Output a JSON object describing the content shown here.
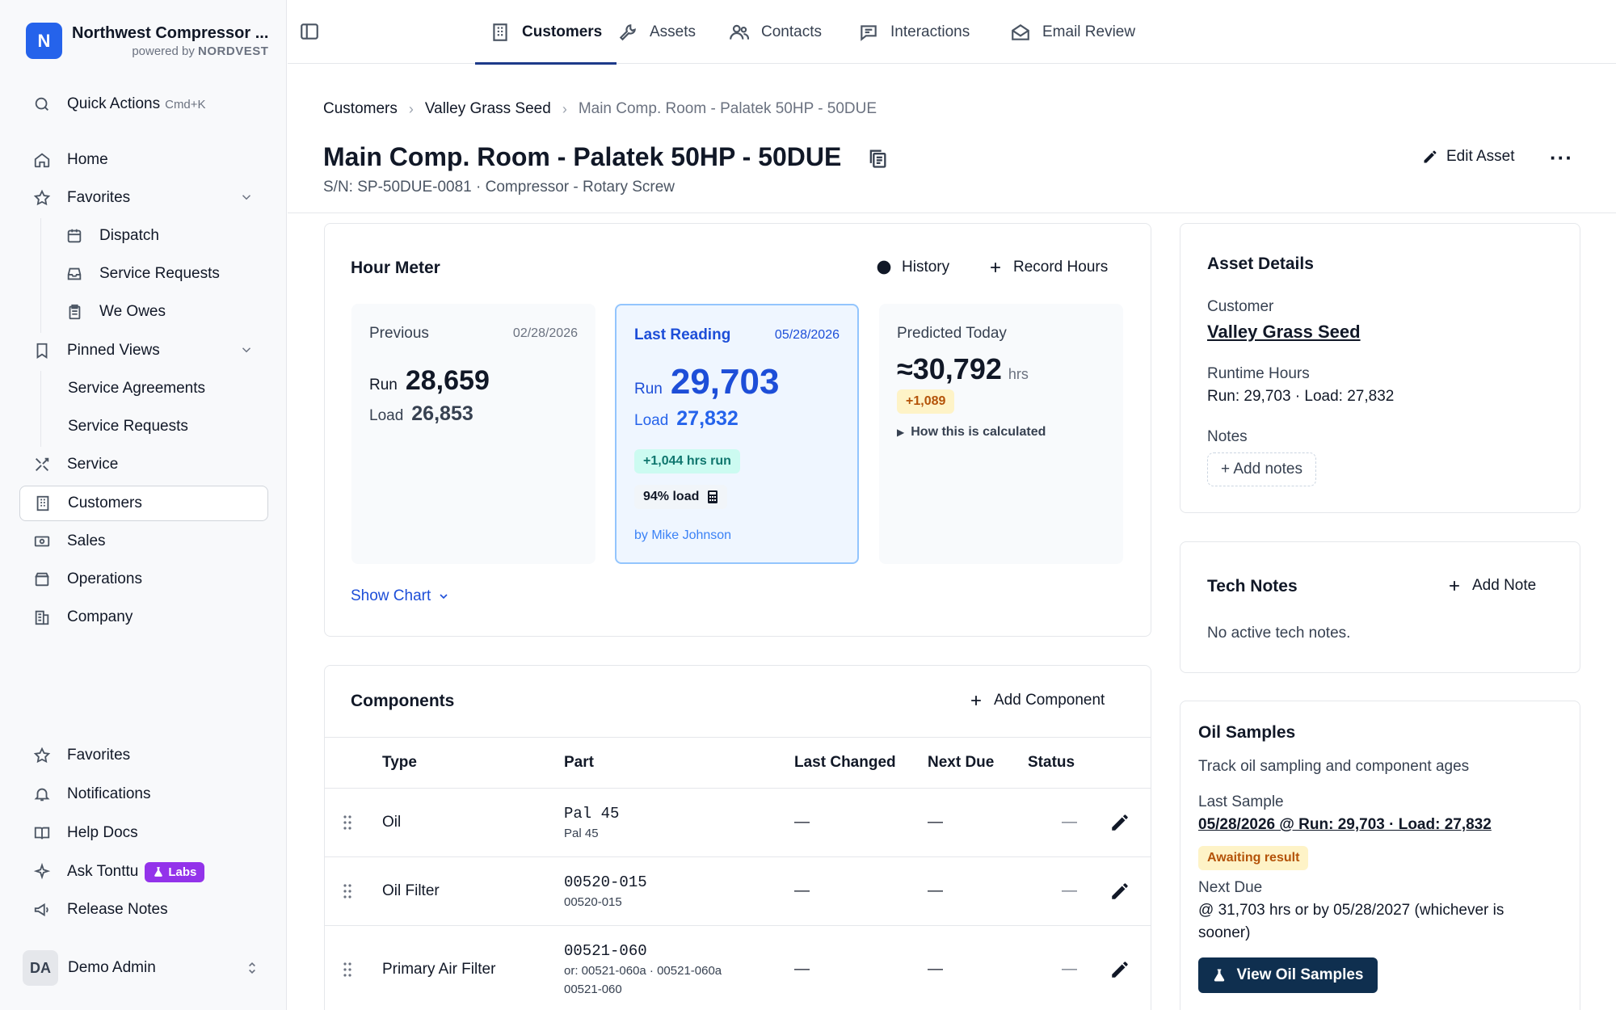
{
  "org": {
    "logo_letter": "N",
    "name": "Northwest Compressor ...",
    "powered_prefix": "powered by",
    "powered_brand": "NORDVEST"
  },
  "sidebar": {
    "quick_actions": {
      "label": "Quick Actions",
      "shortcut": "Cmd+K",
      "icon": "search-icon"
    },
    "home": {
      "label": "Home",
      "icon": "home-icon"
    },
    "favorites": {
      "label": "Favorites",
      "icon": "star-icon"
    },
    "favorites_items": [
      {
        "label": "Dispatch",
        "icon": "calendar-icon"
      },
      {
        "label": "Service Requests",
        "icon": "inbox-icon"
      },
      {
        "label": "We Owes",
        "icon": "clipboard-icon"
      }
    ],
    "pinned": {
      "label": "Pinned Views",
      "icon": "bookmark-icon"
    },
    "pinned_items": [
      {
        "label": "Service Agreements"
      },
      {
        "label": "Service Requests"
      }
    ],
    "main_items": [
      {
        "label": "Service",
        "icon": "tools-icon"
      },
      {
        "label": "Customers",
        "icon": "building-icon"
      },
      {
        "label": "Sales",
        "icon": "money-icon"
      },
      {
        "label": "Operations",
        "icon": "box-icon"
      },
      {
        "label": "Company",
        "icon": "company-icon"
      }
    ],
    "bottom_items": [
      {
        "label": "Favorites",
        "icon": "star-icon"
      },
      {
        "label": "Notifications",
        "icon": "bell-icon"
      },
      {
        "label": "Help Docs",
        "icon": "book-icon"
      },
      {
        "label": "Ask Tonttu",
        "icon": "sparkle-icon",
        "badge": "Labs"
      },
      {
        "label": "Release Notes",
        "icon": "megaphone-icon"
      }
    ],
    "user": {
      "initials": "DA",
      "name": "Demo Admin"
    }
  },
  "topnav": {
    "tabs": [
      {
        "label": "Customers",
        "icon": "building-icon"
      },
      {
        "label": "Assets",
        "icon": "wrench-icon"
      },
      {
        "label": "Contacts",
        "icon": "users-icon"
      },
      {
        "label": "Interactions",
        "icon": "chat-icon"
      },
      {
        "label": "Email Review",
        "icon": "mail-open-icon"
      }
    ],
    "active": "Customers"
  },
  "breadcrumb": [
    "Customers",
    "Valley Grass Seed",
    "Main Comp. Room - Palatek 50HP - 50DUE"
  ],
  "header": {
    "title": "Main Comp. Room - Palatek 50HP - 50DUE",
    "subtitle": "S/N: SP-50DUE-0081 · Compressor - Rotary Screw",
    "edit_label": "Edit Asset",
    "more_label": "···"
  },
  "hour_meter": {
    "title": "Hour Meter",
    "history_label": "History",
    "record_label": "Record Hours",
    "previous": {
      "label": "Previous",
      "date": "02/28/2026",
      "run_key": "Run",
      "run": "28,659",
      "load_key": "Load",
      "load": "26,853"
    },
    "last": {
      "label": "Last Reading",
      "date": "05/28/2026",
      "run_key": "Run",
      "run": "29,703",
      "load_key": "Load",
      "load": "27,832",
      "run_delta": "+1,044 hrs run",
      "load_pct": "94% load",
      "by": "by Mike Johnson"
    },
    "predicted": {
      "label": "Predicted Today",
      "value": "≈30,792",
      "unit": "hrs",
      "delta": "+1,089",
      "how": "How this is calculated"
    },
    "show_chart": "Show Chart"
  },
  "components": {
    "title": "Components",
    "add_label": "Add Component",
    "columns": [
      "Type",
      "Part",
      "Last Changed",
      "Next Due",
      "Status"
    ],
    "rows": [
      {
        "type": "Oil",
        "part": "Pal 45",
        "part_sub": "Pal 45",
        "part_sub2": "",
        "last": "—",
        "next": "—",
        "status": "—"
      },
      {
        "type": "Oil Filter",
        "part": "00520-015",
        "part_sub": "00520-015",
        "part_sub2": "",
        "last": "—",
        "next": "—",
        "status": "—"
      },
      {
        "type": "Primary Air Filter",
        "part": "00521-060",
        "part_sub": "or: 00521-060a · 00521-060a",
        "part_sub2": "00521-060",
        "last": "—",
        "next": "—",
        "status": "—"
      }
    ]
  },
  "asset_details": {
    "title": "Asset Details",
    "customer_label": "Customer",
    "customer": "Valley Grass Seed",
    "runtime_label": "Runtime Hours",
    "runtime": "Run: 29,703 · Load: 27,832",
    "notes_label": "Notes",
    "add_notes": "+ Add notes"
  },
  "tech_notes": {
    "title": "Tech Notes",
    "add_label": "Add Note",
    "empty": "No active tech notes."
  },
  "oil_samples": {
    "title": "Oil Samples",
    "desc": "Track oil sampling and component ages",
    "last_label": "Last Sample",
    "last_value": "05/28/2026 @ Run: 29,703 · Load: 27,832",
    "status": "Awaiting result",
    "next_label": "Next Due",
    "next_value_1": "@ 31,703 hrs or by 05/28/2027 (whichever is",
    "next_value_2": "sooner)",
    "button": "View Oil Samples"
  },
  "colors": {
    "accent": "#2563eb",
    "nav_underline": "#1e3a8a",
    "labs": "#9333ea",
    "button_dark": "#0f2f4f"
  }
}
